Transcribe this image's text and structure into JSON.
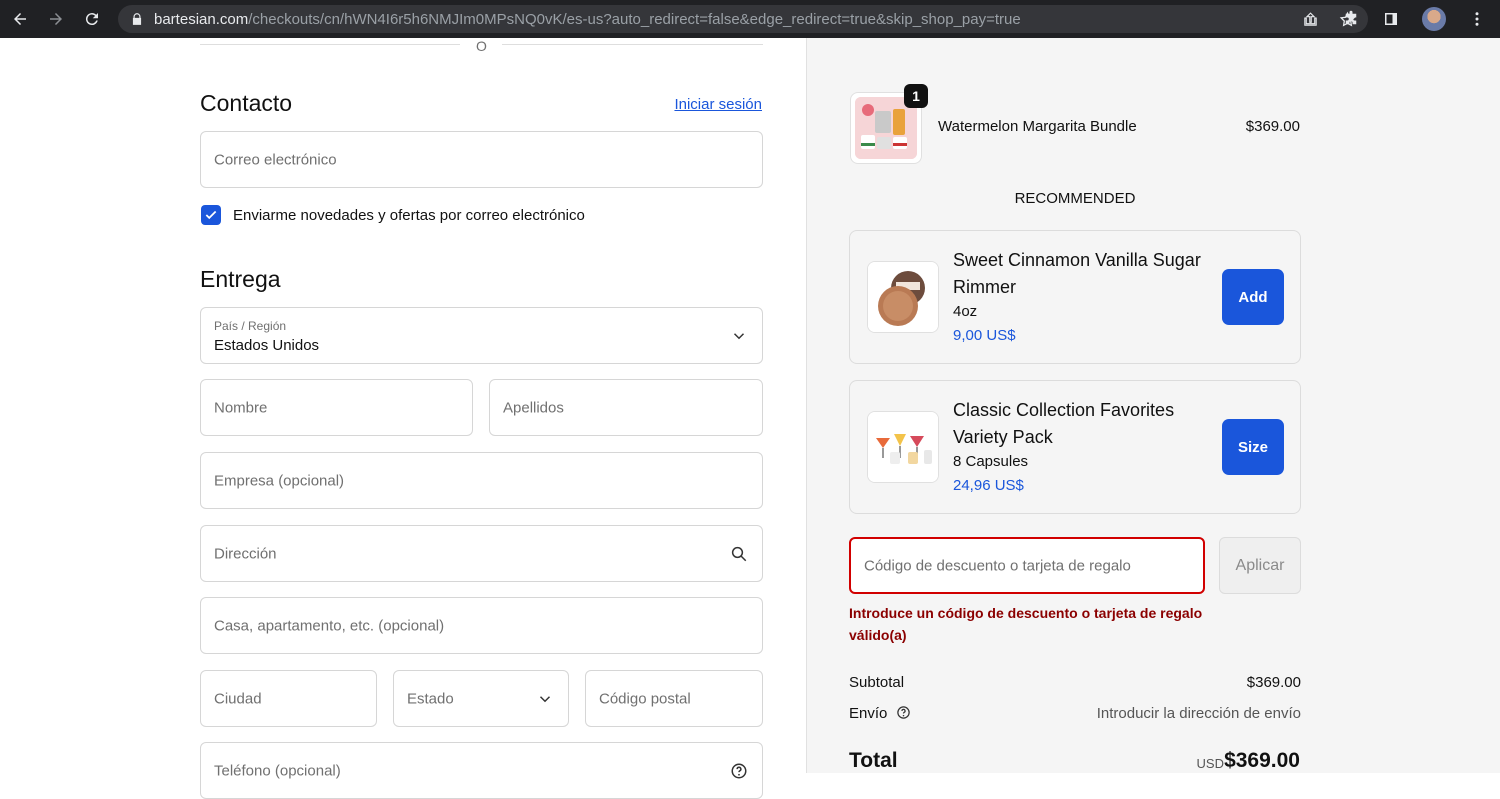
{
  "browser": {
    "url_domain": "bartesian.com",
    "url_path": "/checkouts/cn/hWN4I6r5h6NMJIm0MPsNQ0vK/es-us?auto_redirect=false&edge_redirect=true&skip_shop_pay=true"
  },
  "divider": {
    "text": "O"
  },
  "contact": {
    "title": "Contacto",
    "login_link": "Iniciar sesión",
    "email_placeholder": "Correo electrónico",
    "newsletter_label": "Enviarme novedades y ofertas por correo electrónico",
    "newsletter_checked": true
  },
  "delivery": {
    "title": "Entrega",
    "country_label": "País / Región",
    "country_value": "Estados Unidos",
    "first_name_placeholder": "Nombre",
    "last_name_placeholder": "Apellidos",
    "company_placeholder": "Empresa (opcional)",
    "address_placeholder": "Dirección",
    "apartment_placeholder": "Casa, apartamento, etc. (opcional)",
    "city_placeholder": "Ciudad",
    "state_placeholder": "Estado",
    "zip_placeholder": "Código postal",
    "phone_placeholder": "Teléfono (opcional)"
  },
  "order": {
    "item_name": "Watermelon Margarita Bundle",
    "item_price": "$369.00",
    "item_quantity": "1",
    "recommended_title": "RECOMMENDED",
    "recommendations": [
      {
        "name": "Sweet Cinnamon Vanilla Sugar Rimmer",
        "subtitle": "4oz",
        "price": "9,00 US$",
        "button": "Add"
      },
      {
        "name": "Classic Collection Favorites Variety Pack",
        "subtitle": "8 Capsules",
        "price": "24,96 US$",
        "button": "Size"
      }
    ],
    "discount_placeholder": "Código de descuento o tarjeta de regalo",
    "apply_label": "Aplicar",
    "discount_error": "Introduce un código de descuento o tarjeta de regalo válido(a)",
    "subtotal_label": "Subtotal",
    "subtotal_value": "$369.00",
    "shipping_label": "Envío",
    "shipping_value": "Introducir la dirección de envío",
    "total_label": "Total",
    "total_currency": "USD",
    "total_value": "$369.00"
  },
  "colors": {
    "accent": "#1a56db",
    "error": "#d10000",
    "sidebar_bg": "#f5f5f5"
  }
}
